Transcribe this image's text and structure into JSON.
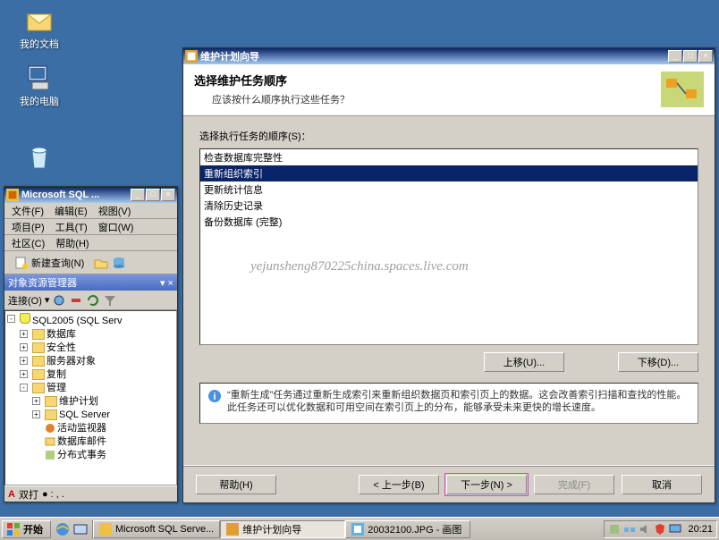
{
  "desktop": {
    "icons": [
      {
        "name": "my-documents",
        "label": "我的文档"
      },
      {
        "name": "my-computer",
        "label": "我的电脑"
      },
      {
        "name": "recycle-bin",
        "label": ""
      }
    ]
  },
  "sql_window": {
    "title": "Microsoft SQL ...",
    "menus": {
      "file": "文件(F)",
      "edit": "编辑(E)",
      "view": "视图(V)",
      "project": "项目(P)",
      "tools": "工具(T)",
      "window": "窗口(W)",
      "community": "社区(C)",
      "help": "帮助(H)"
    },
    "new_query": "新建查询(N)",
    "pane_header": "对象资源管理器",
    "connect_label": "连接(O)",
    "tree_root": "SQL2005 (SQL Serv",
    "nodes": {
      "databases": "数据库",
      "security": "安全性",
      "server_objects": "服务器对象",
      "replication": "复制",
      "management": "管理",
      "maint_plans": "维护计划",
      "sql_server": "SQL Server",
      "activity_monitor": "活动监视器",
      "db_mail": "数据库邮件",
      "dtx": "分布式事务"
    },
    "status_toggle": "双打"
  },
  "wizard": {
    "title": "维护计划向导",
    "header_title": "选择维护任务顺序",
    "header_sub": "应该按什么顺序执行这些任务？",
    "list_label": "选择执行任务的顺序(S)：",
    "tasks": [
      "检查数据库完整性",
      "重新组织索引",
      "更新统计信息",
      "清除历史记录",
      "备份数据库 (完整)"
    ],
    "selected_index": 1,
    "move_up": "上移(U)...",
    "move_down": "下移(D)...",
    "info_text": "“重新生成”任务通过重新生成索引来重新组织数据页和索引页上的数据。这会改善索引扫描和查找的性能。此任务还可以优化数据和可用空间在索引页上的分布，能够承受未来更快的增长速度。",
    "btn_help": "帮助(H)",
    "btn_back": "< 上一步(B)",
    "btn_next": "下一步(N) >",
    "btn_finish": "完成(F)",
    "btn_cancel": "取消"
  },
  "watermark": "yejunsheng870225china.spaces.live.com",
  "taskbar": {
    "start": "开始",
    "tasks": [
      "Microsoft SQL Serve...",
      "维护计划向导",
      "20032100.JPG - 画图"
    ],
    "clock": "20:21"
  }
}
